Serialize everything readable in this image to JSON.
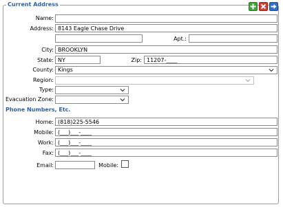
{
  "section": {
    "title": "Current Address"
  },
  "toolbar": {
    "add_icon": "plus-icon",
    "delete_icon": "close-icon",
    "go_icon": "arrow-right-icon"
  },
  "address": {
    "name_label": "Name:",
    "name_value": "",
    "address_label": "Address:",
    "address_value": "8143 Eagle Chase Drive",
    "address2_value": "",
    "apt_label": "Apt.:",
    "apt_value": "",
    "city_label": "City:",
    "city_value": "BROOKLYN",
    "state_label": "State:",
    "state_value": "NY",
    "zip_label": "Zip:",
    "zip_value": "11207-____",
    "county_label": "County:",
    "county_value": "Kings",
    "region_label": "Region:",
    "region_value": "",
    "type_label": "Type:",
    "type_value": "",
    "evac_label": "Evacuation Zone:",
    "evac_value": ""
  },
  "phones": {
    "title": "Phone Numbers, Etc.",
    "home_label": "Home:",
    "home_value": "(818)225-5546",
    "mobile_label": "Mobile:",
    "mobile_value": "(___)___-____",
    "work_label": "Work:",
    "work_value": "(___)___-____",
    "fax_label": "Fax:",
    "fax_value": "(___)___-____",
    "email_label": "Email:",
    "email_value": "",
    "mobile_check_label": "Mobile:",
    "mobile_checked": false
  }
}
